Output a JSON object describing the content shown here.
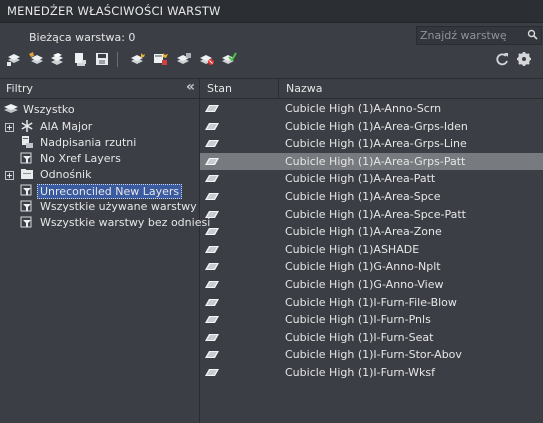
{
  "title": "MENEDŻER WŁAŚCIWOŚCI WARSTW",
  "current_layer": "Bieżąca warstwa: 0",
  "search": {
    "placeholder": "Znajdź warstwę"
  },
  "toolbar": {
    "left_icons": [
      "new-filter-icon",
      "new-group-filter-icon",
      "layer-states-icon",
      "settings-layer-icon",
      "save-icon"
    ],
    "layer_icons": [
      "new-layer-icon",
      "new-layer-vp-frozen-icon",
      "delete-layer-icon",
      "set-current-icon",
      "accept-icon"
    ],
    "right_icons": [
      "refresh-icon",
      "gear-icon"
    ]
  },
  "filters": {
    "header": "Filtry",
    "collapse": "«",
    "items": [
      {
        "label": "Wszystko",
        "icon": "layers-icon",
        "level": 0
      },
      {
        "label": "AIA Major",
        "icon": "snowflake-icon",
        "level": 1,
        "expander": true
      },
      {
        "label": "Nadpisania rzutni",
        "icon": "viewport-overrides-icon",
        "level": 1
      },
      {
        "label": "No Xref Layers",
        "icon": "filter-icon",
        "level": 1
      },
      {
        "label": "Odnośnik",
        "icon": "xref-folder-icon",
        "level": 1,
        "expander": true
      },
      {
        "label": "Unreconciled New Layers",
        "icon": "filter-icon",
        "level": 1,
        "selected": true
      },
      {
        "label": "Wszystkie używane warstwy",
        "icon": "filter-icon",
        "level": 1
      },
      {
        "label": "Wszystkie warstwy bez odniesi",
        "icon": "filter-icon",
        "level": 1
      }
    ]
  },
  "layers": {
    "columns": {
      "status": "Stan",
      "name": "Nazwa"
    },
    "rows": [
      {
        "name": "Cubicle High (1)A-Anno-Scrn"
      },
      {
        "name": "Cubicle High (1)A-Area-Grps-Iden"
      },
      {
        "name": "Cubicle High (1)A-Area-Grps-Line"
      },
      {
        "name": "Cubicle High (1)A-Area-Grps-Patt",
        "highlighted": true
      },
      {
        "name": "Cubicle High (1)A-Area-Patt"
      },
      {
        "name": "Cubicle High (1)A-Area-Spce"
      },
      {
        "name": "Cubicle High (1)A-Area-Spce-Patt"
      },
      {
        "name": "Cubicle High (1)A-Area-Zone"
      },
      {
        "name": "Cubicle High (1)ASHADE"
      },
      {
        "name": "Cubicle High (1)G-Anno-Nplt"
      },
      {
        "name": "Cubicle High (1)G-Anno-View"
      },
      {
        "name": "Cubicle High (1)I-Furn-File-Blow"
      },
      {
        "name": "Cubicle High (1)I-Furn-Pnls"
      },
      {
        "name": "Cubicle High (1)I-Furn-Seat"
      },
      {
        "name": "Cubicle High (1)I-Furn-Stor-Abov"
      },
      {
        "name": "Cubicle High (1)I-Furn-Wksf"
      }
    ]
  }
}
